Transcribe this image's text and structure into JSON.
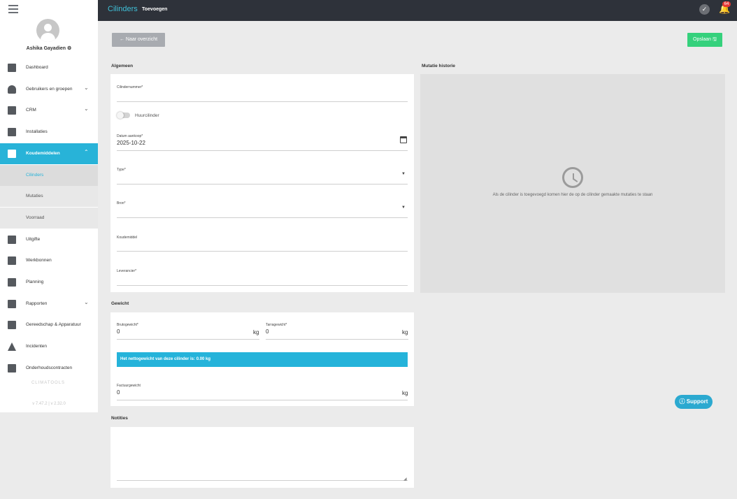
{
  "topbar": {
    "title": "Cilinders",
    "subtitle": "Toevoegen",
    "notification_count": "64"
  },
  "user": {
    "name": "Ashika Gayadien ⚙"
  },
  "nav": [
    {
      "label": "Dashboard",
      "icon": "dashboard-icon"
    },
    {
      "label": "Gebruikers en groepen",
      "icon": "user-icon",
      "expandable": true
    },
    {
      "label": "CRM",
      "icon": "handshake-icon",
      "expandable": true
    },
    {
      "label": "Installaties",
      "icon": "installation-icon"
    },
    {
      "label": "Koudemiddelen",
      "icon": "cylinder-icon",
      "expandable": true,
      "active": true
    },
    {
      "label": "Uitgifte",
      "icon": "exit-icon"
    },
    {
      "label": "Werkbonnen",
      "icon": "workorder-icon"
    },
    {
      "label": "Planning",
      "icon": "calendar-icon"
    },
    {
      "label": "Rapporten",
      "icon": "report-icon",
      "expandable": true
    },
    {
      "label": "Gereedschap & Apparatuur",
      "icon": "wrench-icon"
    },
    {
      "label": "Incidenten",
      "icon": "warning-icon"
    },
    {
      "label": "Onderhoudscontracten",
      "icon": "contract-icon"
    }
  ],
  "subnav": [
    {
      "label": "Cilinders",
      "selected": true
    },
    {
      "label": "Mutaties"
    },
    {
      "label": "Voorraad"
    }
  ],
  "brand": {
    "logo_text": "CLIMATOOLS",
    "version": "v 7.47.2 | v 2.32.0"
  },
  "actions": {
    "back_label": "← Naar overzicht",
    "save_label": "Opslaan 🖫"
  },
  "algemeen": {
    "title": "Algemeen",
    "cilindernummer_label": "Cilindernummer*",
    "huur_label": "Huurcilinder",
    "datum_label": "Datum aankoop*",
    "datum_value": "2025-10-22",
    "type_label": "Type*",
    "bron_label": "Bron*",
    "koudemiddel_label": "Koudemiddel",
    "leverancier_label": "Leverancier*"
  },
  "history": {
    "title": "Mutatie historie",
    "empty_text": "Als de cilinder is toegevoegd komen hier de op de cilinder gemaakte mutaties te staan"
  },
  "gewicht": {
    "title": "Gewicht",
    "bruto_label": "Brutogewicht*",
    "bruto_value": "0",
    "tarra_label": "Tarragewicht*",
    "tarra_value": "0",
    "unit": "kg",
    "info": "Het nettogewicht van deze cilinder is: 0.00 kg",
    "factuur_label": "Factuurgewicht",
    "factuur_value": "0"
  },
  "notities": {
    "title": "Notities"
  },
  "support": {
    "label": "ⓘ Support"
  }
}
